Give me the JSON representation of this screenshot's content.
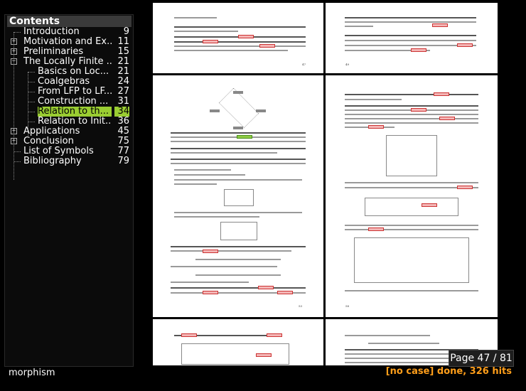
{
  "toc": {
    "title": "Contents",
    "items": [
      {
        "label": "Introduction",
        "page": "9",
        "expander": ""
      },
      {
        "label": "Motivation and Ex...",
        "page": "11",
        "expander": "+"
      },
      {
        "label": "Preliminaries",
        "page": "15",
        "expander": "+"
      },
      {
        "label": "The Locally Finite ...",
        "page": "21",
        "expander": "−"
      },
      {
        "label": "Basics on Loc...",
        "page": "21",
        "expander": ""
      },
      {
        "label": "Coalgebras",
        "page": "24",
        "expander": ""
      },
      {
        "label": "From LFP to LF...",
        "page": "27",
        "expander": ""
      },
      {
        "label": "Construction ...",
        "page": "31",
        "expander": ""
      },
      {
        "label": "Relation to th...",
        "page": "34",
        "expander": ""
      },
      {
        "label": "Relation to Init...",
        "page": "36",
        "expander": ""
      },
      {
        "label": "Applications",
        "page": "45",
        "expander": "+"
      },
      {
        "label": "Conclusion",
        "page": "75",
        "expander": "+"
      },
      {
        "label": "List of Symbols",
        "page": "77",
        "expander": ""
      },
      {
        "label": "Bibliography",
        "page": "79",
        "expander": ""
      }
    ]
  },
  "viewer": {
    "page_indicator": "Page 47 / 81"
  },
  "search": {
    "query": "morphism",
    "status": "[no case] done, 326 hits"
  },
  "pages": {
    "numbers": [
      "47",
      "49",
      "53",
      "58"
    ]
  },
  "colors": {
    "selected": "#9acd32",
    "hit_highlight": "#f4b6b6",
    "status_accent": "#ff9e1a"
  }
}
